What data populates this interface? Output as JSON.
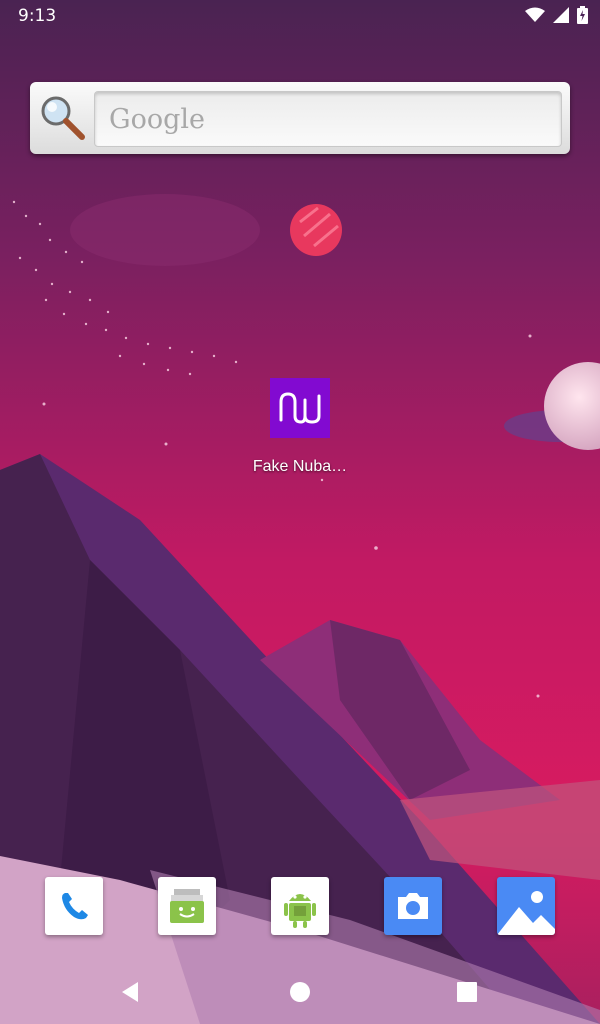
{
  "status_bar": {
    "time": "9:13",
    "icons": [
      "wifi-icon",
      "cell-signal-icon",
      "battery-charging-icon"
    ]
  },
  "search_widget": {
    "placeholder": "Google",
    "icon": "magnifier-icon"
  },
  "home_apps": [
    {
      "label": "Fake Nuba…",
      "icon": "nubank-logo-icon",
      "color": "#820ad1"
    }
  ],
  "dock": [
    {
      "icon": "phone-icon",
      "color": "#1e88e5"
    },
    {
      "icon": "messaging-icon",
      "color": "#8bc34a"
    },
    {
      "icon": "android-robot-icon",
      "color": "#8bc34a"
    },
    {
      "icon": "camera-icon",
      "color": "#4a8af4"
    },
    {
      "icon": "gallery-icon",
      "color": "#4a8af4"
    }
  ],
  "nav_bar": {
    "buttons": [
      "back-icon",
      "home-icon",
      "recents-icon"
    ]
  }
}
